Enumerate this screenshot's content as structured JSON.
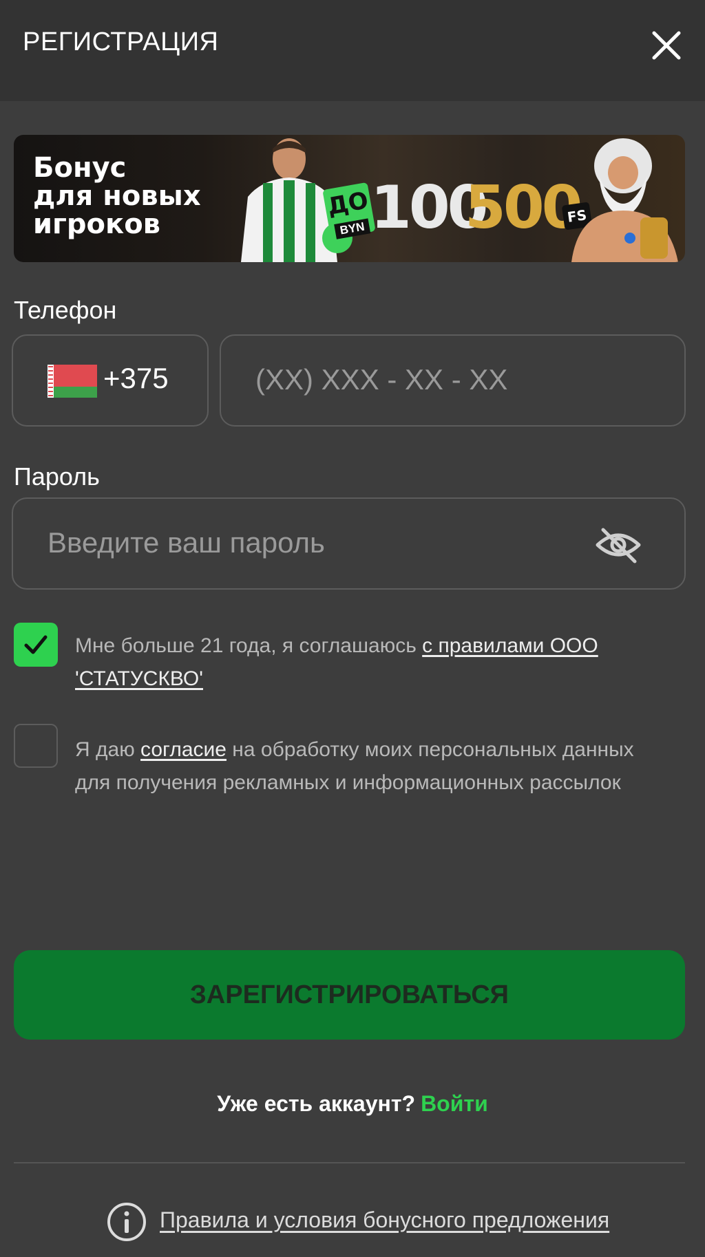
{
  "header": {
    "title": "РЕГИСТРАЦИЯ",
    "close_icon": "close-icon"
  },
  "banner": {
    "title": "Бонус\nдля новых\nигроков",
    "badge_prefix": "ДО",
    "currency": "BYN",
    "amount_1": "100",
    "amount_2": "500",
    "fs_label": "FS"
  },
  "phone": {
    "label": "Телефон",
    "country_flag": "belarus-flag-icon",
    "country_code": "+375",
    "placeholder": "(XX) XXX - XX - XX"
  },
  "password": {
    "label": "Пароль",
    "placeholder": "Введите ваш пароль",
    "toggle_icon": "eye-off-icon"
  },
  "agreement_age": {
    "checked": true,
    "text": "Мне больше 21 года, я соглашаюсь ",
    "link": "с правилами ООО 'СТАТУСКВО'"
  },
  "agreement_marketing": {
    "checked": false,
    "text_before": "Я даю ",
    "link": "согласие",
    "text_after": " на обработку моих персональных данных для получения рекламных и информационных рассылок"
  },
  "submit": {
    "label": "ЗАРЕГИСТРИРОВАТЬСЯ"
  },
  "account": {
    "question": "Уже есть аккаунт?",
    "login_link": "Войти"
  },
  "footer": {
    "info_icon": "info-icon",
    "bonus_terms_link": "Правила и условия бонусного предложения"
  },
  "colors": {
    "background": "#3d3d3d",
    "header": "#333333",
    "accent_green": "#2ed14f",
    "submit_button": "#0b7a2e"
  }
}
